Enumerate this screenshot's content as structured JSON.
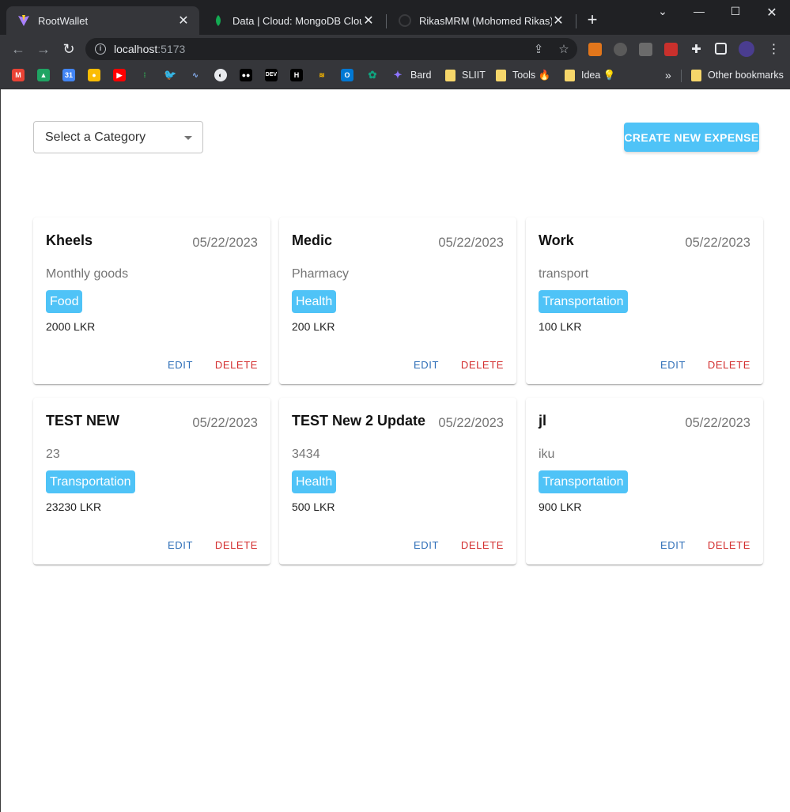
{
  "browser": {
    "tabs": [
      {
        "title": "RootWallet",
        "active": true,
        "icon": "vite-icon"
      },
      {
        "title": "Data | Cloud: MongoDB Cloud",
        "active": false,
        "icon": "mongodb-leaf-icon"
      },
      {
        "title": "RikasMRM (Mohomed Rikas)",
        "active": false,
        "icon": "github-icon"
      }
    ],
    "url": {
      "host": "localhost",
      "port": ":5173"
    },
    "bookmarks": [
      {
        "label": "Bard",
        "icon": "bard-sparkle-icon"
      },
      {
        "label": "SLIIT",
        "icon": "folder-icon"
      },
      {
        "label": "Tools 🔥",
        "icon": "folder-icon"
      },
      {
        "label": "Idea 💡",
        "icon": "folder-icon"
      }
    ],
    "other_bookmarks": "Other bookmarks",
    "overflow": "»"
  },
  "filter": {
    "placeholder": "Select a Category"
  },
  "create_button": "CREATE NEW EXPENSE",
  "colors": {
    "accent": "#4fc3f7",
    "edit": "#2e6fb8",
    "delete": "#d32f2f"
  },
  "expenses": [
    {
      "name": "Kheels",
      "date": "05/22/2023",
      "description": "Monthly goods",
      "category": "Food",
      "amount": "2000 LKR",
      "edit": "EDIT",
      "delete": "DELETE"
    },
    {
      "name": "Medic",
      "date": "05/22/2023",
      "description": "Pharmacy",
      "category": "Health",
      "amount": "200 LKR",
      "edit": "EDIT",
      "delete": "DELETE"
    },
    {
      "name": "Work",
      "date": "05/22/2023",
      "description": "transport",
      "category": "Transportation",
      "amount": "100 LKR",
      "edit": "EDIT",
      "delete": "DELETE"
    },
    {
      "name": "TEST NEW",
      "date": "05/22/2023",
      "description": "23",
      "category": "Transportation",
      "amount": "23230 LKR",
      "edit": "EDIT",
      "delete": "DELETE"
    },
    {
      "name": "TEST New 2 Update",
      "date": "05/22/2023",
      "description": "3434",
      "category": "Health",
      "amount": "500 LKR",
      "edit": "EDIT",
      "delete": "DELETE"
    },
    {
      "name": "jl",
      "date": "05/22/2023",
      "description": "iku",
      "category": "Transportation",
      "amount": "900 LKR",
      "edit": "EDIT",
      "delete": "DELETE"
    }
  ]
}
